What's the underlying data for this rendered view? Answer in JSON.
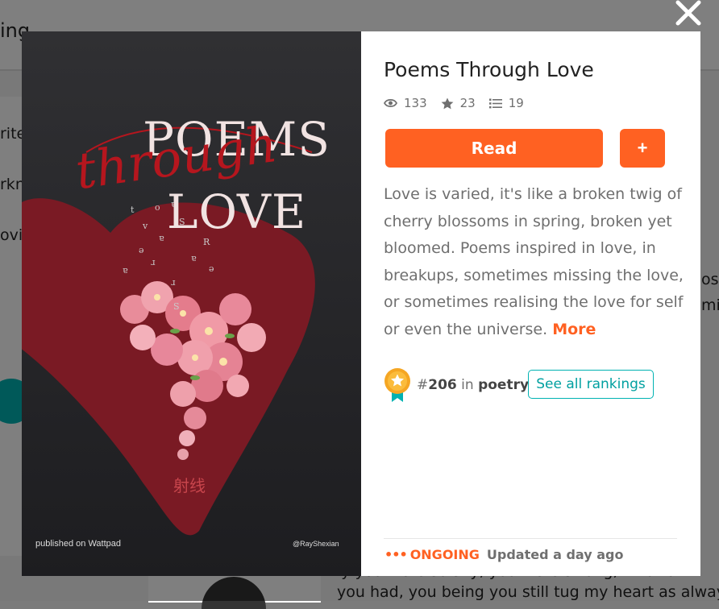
{
  "background": {
    "topbar_text": "ing",
    "side_items": [
      "rite",
      "rkn",
      "ovic"
    ],
    "right_fragments": [
      "oss",
      "mi"
    ],
    "bottom_text_1": "ly you were so shy, you were strong, kind to",
    "bottom_text_2": "you had, you being you still tug my heart as always"
  },
  "modal": {
    "cover": {
      "title_line1": "POEMS",
      "title_script": "through",
      "title_line3": "LOVE",
      "chinese": "射线",
      "published_on": "published on Wattpad",
      "author_handle": "@RayShexian"
    },
    "book": {
      "title": "Poems Through Love",
      "stats": {
        "reads": "133",
        "votes": "23",
        "parts": "19"
      },
      "read_label": "Read",
      "add_label": "+",
      "description": "Love is varied, it's like a broken twig of cherry blossoms in spring, broken yet bloomed. Poems inspired in love, in breakups, sometimes missing the love, or sometimes realising the love for self or even the universe. ",
      "more_label": "More",
      "ranking": {
        "hash": "#",
        "number": "206",
        "in_word": " in ",
        "category": "poetry"
      },
      "see_rankings_label": "See all rankings",
      "status_dots": "•••",
      "status_label": "ONGOING",
      "updated": "Updated a day ago"
    }
  },
  "colors": {
    "accent": "#ff6122",
    "teal": "#00b2b2",
    "cover_bg": "#2a2a2d",
    "heart": "#7a1a24"
  },
  "icons": {
    "close": "close-icon",
    "reads": "eye-icon",
    "votes": "star-icon",
    "parts": "list-icon",
    "badge": "ribbon-badge-icon"
  }
}
